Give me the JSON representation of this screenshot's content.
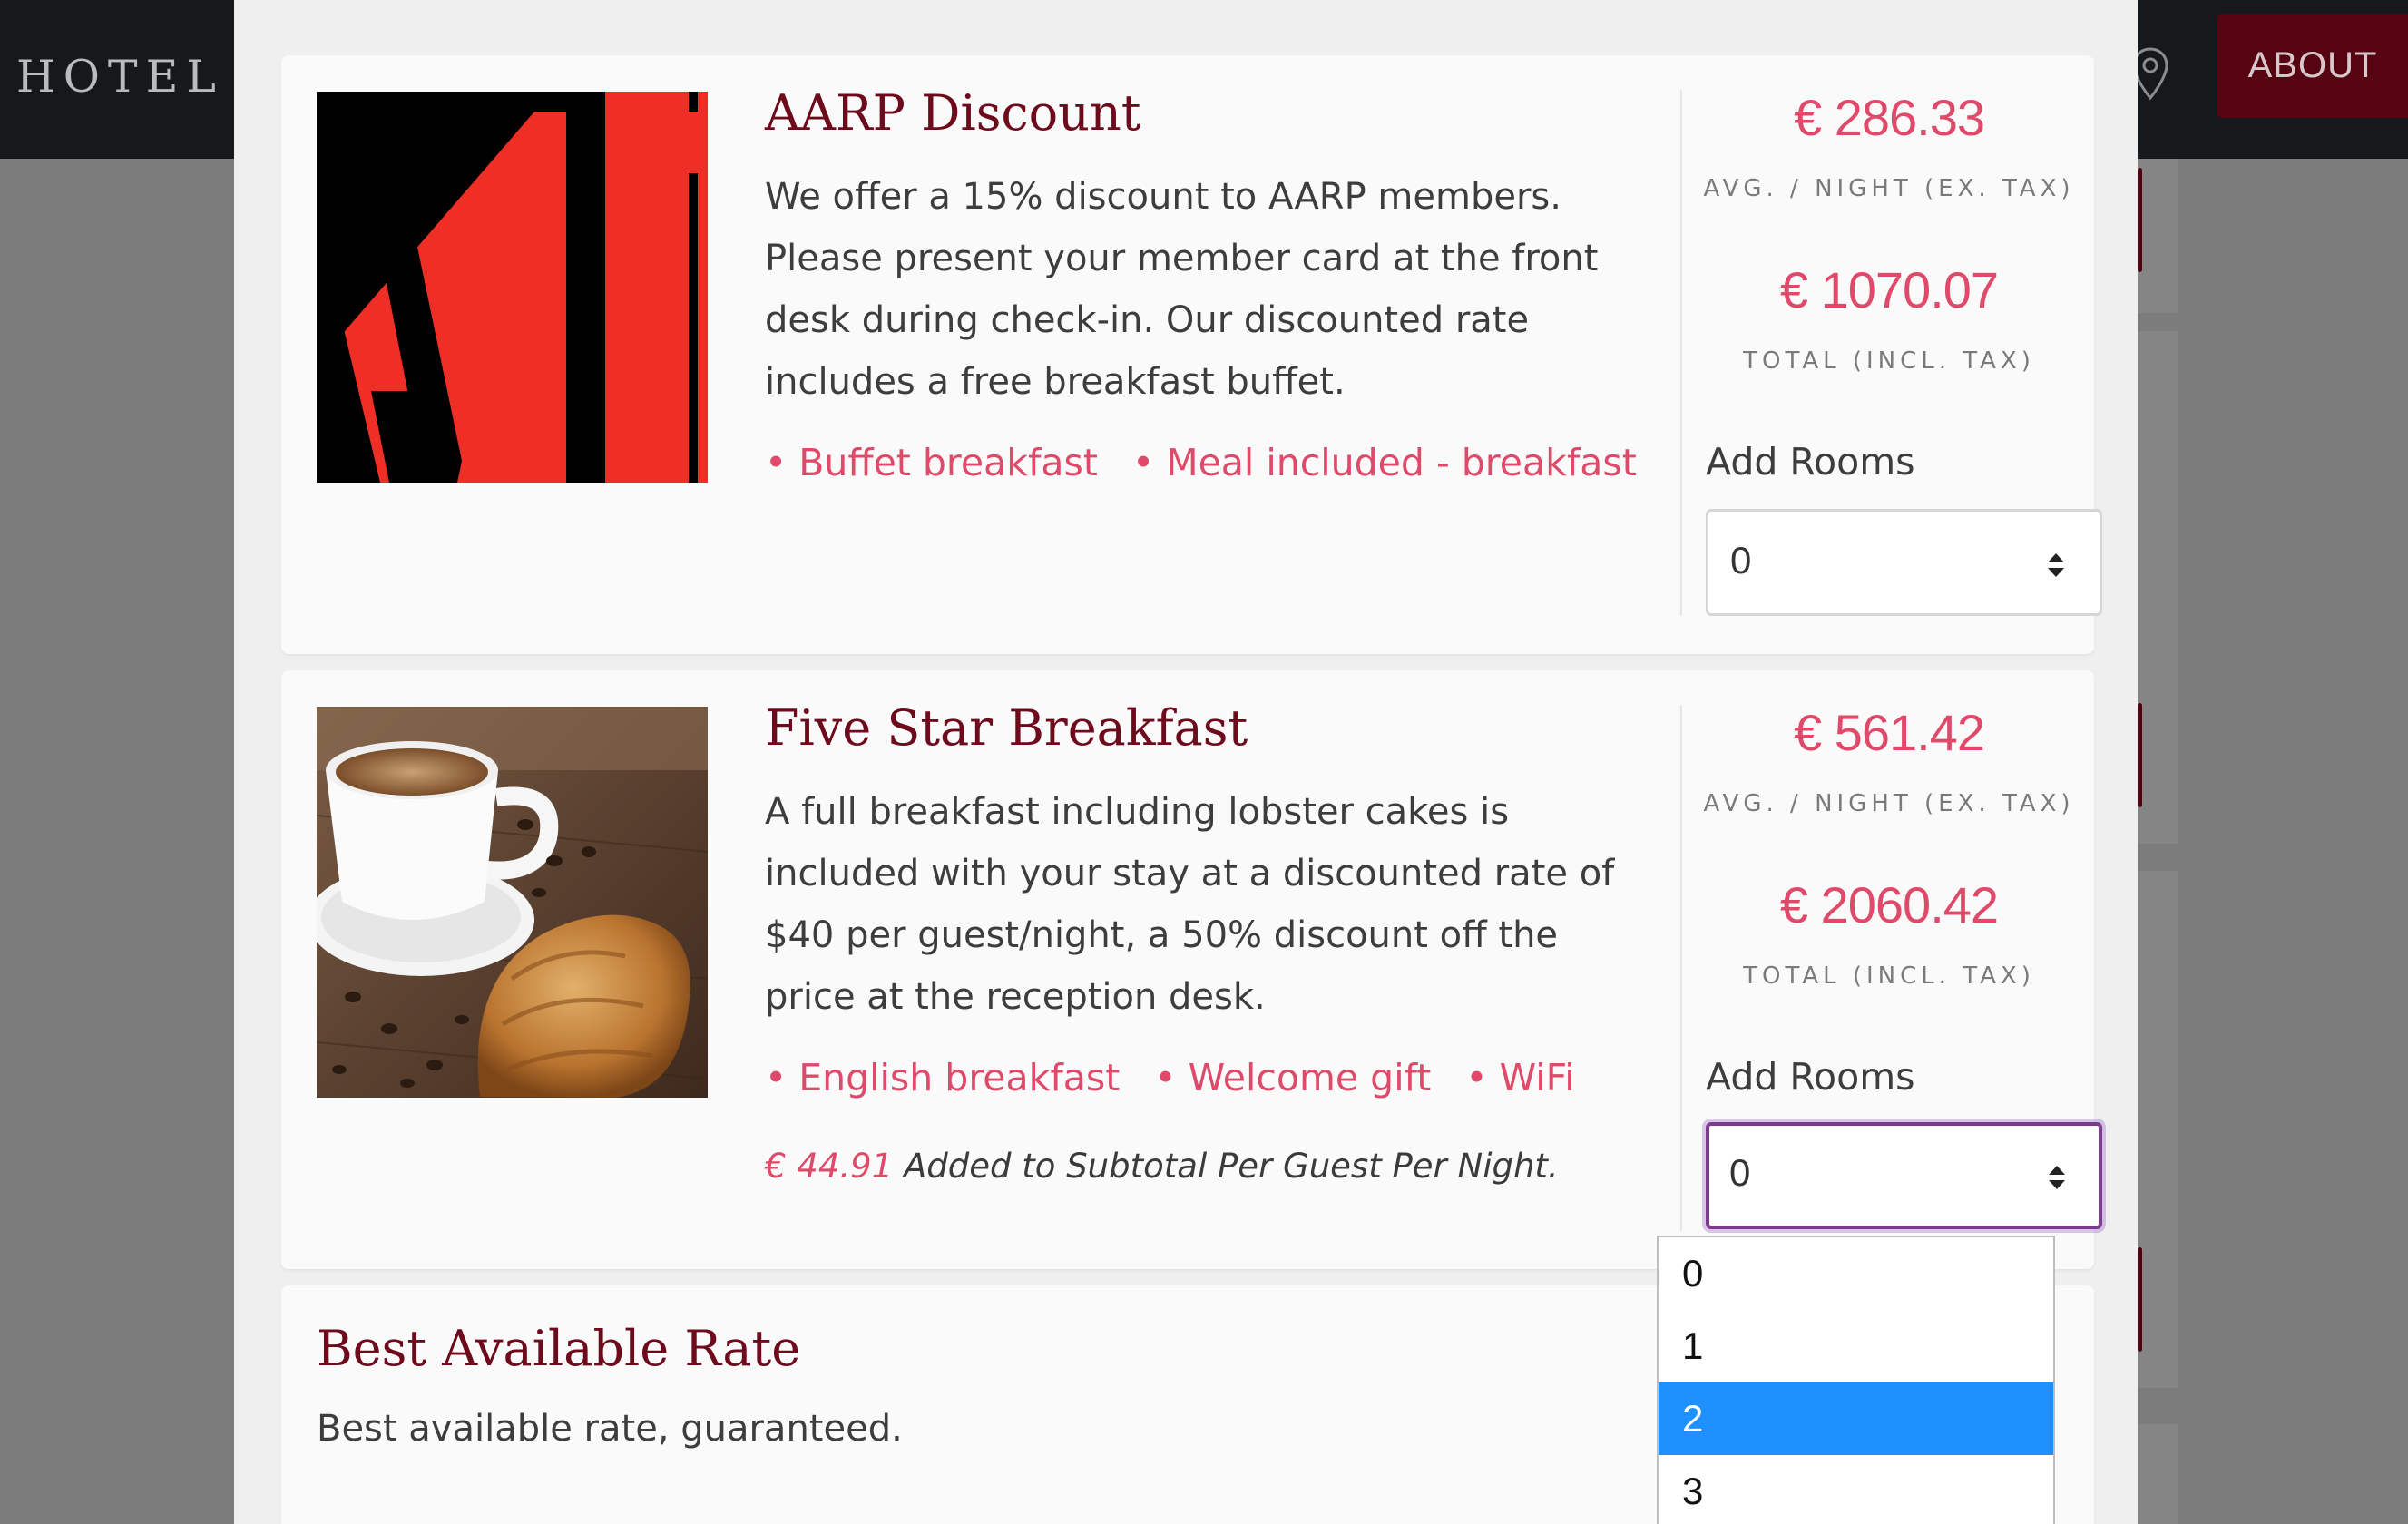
{
  "header": {
    "brand": "HOTEL Y",
    "about_label": "ABOUT"
  },
  "offers": [
    {
      "title": "AARP Discount",
      "description": "We offer a 15% discount to AARP members. Please present your member card at the front desk during check-in. Our discounted rate includes a free breakfast buffet.",
      "tags": [
        "• Buffet breakfast",
        "• Meal included - breakfast"
      ],
      "avg_price": "€ 286.33",
      "avg_label": "AVG. / NIGHT (EX. TAX)",
      "total_price": "€ 1070.07",
      "total_label": "TOTAL (INCL. TAX)",
      "add_rooms_label": "Add Rooms",
      "rooms_value": "0",
      "image": "aarp-logo"
    },
    {
      "title": "Five Star Breakfast",
      "description": "A full breakfast including lobster cakes is included with your stay at a discounted rate of $40 per guest/night, a 50% discount off the price at the reception desk.",
      "tags": [
        "• English breakfast",
        "• Welcome gift",
        "• WiFi"
      ],
      "addon_amount": "€ 44.91",
      "addon_text": " Added to Subtotal Per Guest Per Night.",
      "avg_price": "€ 561.42",
      "avg_label": "AVG. / NIGHT (EX. TAX)",
      "total_price": "€ 2060.42",
      "total_label": "TOTAL (INCL. TAX)",
      "add_rooms_label": "Add Rooms",
      "rooms_value": "0",
      "image": "coffee-croissant-photo"
    },
    {
      "title": "Best Available Rate",
      "description": "Best available rate, guaranteed."
    }
  ],
  "rooms_dropdown": {
    "options": [
      "0",
      "1",
      "2",
      "3"
    ],
    "highlighted": "2"
  },
  "colors": {
    "accent": "#e04a6a",
    "title": "#6d0a1b",
    "header_bg": "#16191c",
    "about_bg": "#560412",
    "dropdown_highlight": "#1e90ff",
    "focus_ring": "#7b3a8e"
  },
  "icons": [
    "map-pin-icon",
    "select-arrows-icon"
  ]
}
